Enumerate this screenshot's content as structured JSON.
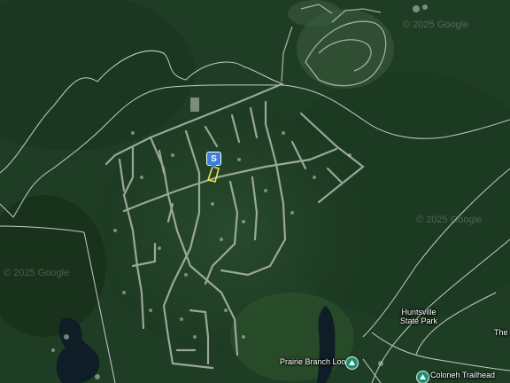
{
  "map": {
    "type": "satellite",
    "labels": {
      "park": [
        "Huntsville",
        "State Park"
      ],
      "prairie_branch_loop": "Prairie Branch Loop",
      "coloneh_trailhead": "Coloneh Trailhead",
      "edge_text": "The"
    },
    "watermark": "© 2025 Google",
    "marker": {
      "label": "S",
      "color": "#3d7fd9"
    },
    "parcel_color": "#f4e94a",
    "poi_color": "#1e8f6e",
    "icons": {
      "poi": "hiking-trail-icon",
      "marker": "map-pin-icon"
    }
  }
}
